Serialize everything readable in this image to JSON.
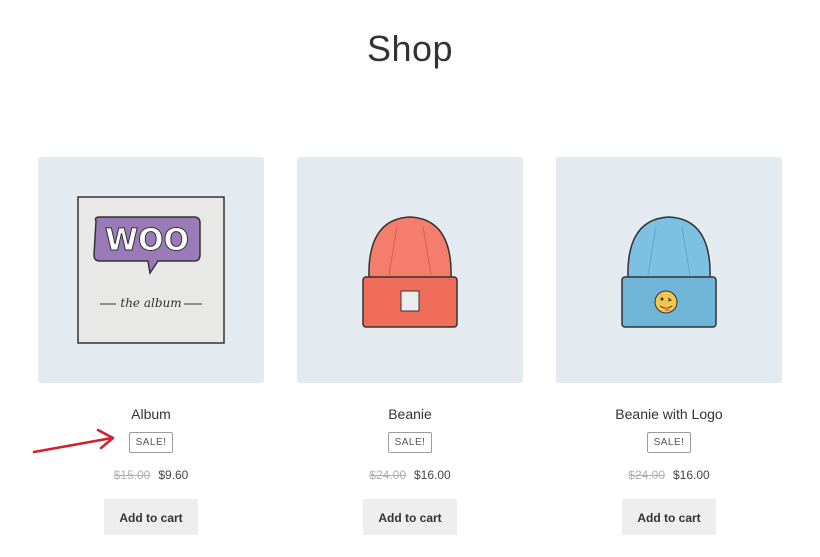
{
  "page": {
    "title": "Shop"
  },
  "products": [
    {
      "name": "Album",
      "image_icon": "woo-album-icon",
      "image_text": "WOO",
      "image_subtext": "the album",
      "badge": "SALE!",
      "price_old": "$15.00",
      "price_new": "$9.60",
      "button_label": "Add to cart"
    },
    {
      "name": "Beanie",
      "image_icon": "beanie-icon",
      "badge": "SALE!",
      "price_old": "$24.00",
      "price_new": "$16.00",
      "button_label": "Add to cart"
    },
    {
      "name": "Beanie with Logo",
      "image_icon": "beanie-logo-icon",
      "badge": "SALE!",
      "price_old": "$24.00",
      "price_new": "$16.00",
      "button_label": "Add to cart"
    }
  ],
  "colors": {
    "image_background": "#e3ebf0",
    "button_background": "#eeeeee",
    "annotation_arrow": "#d0202a",
    "beanie_orange": "#f57d6b",
    "beanie_blue": "#7cc0e2",
    "woo_purple": "#9b7ab8"
  }
}
